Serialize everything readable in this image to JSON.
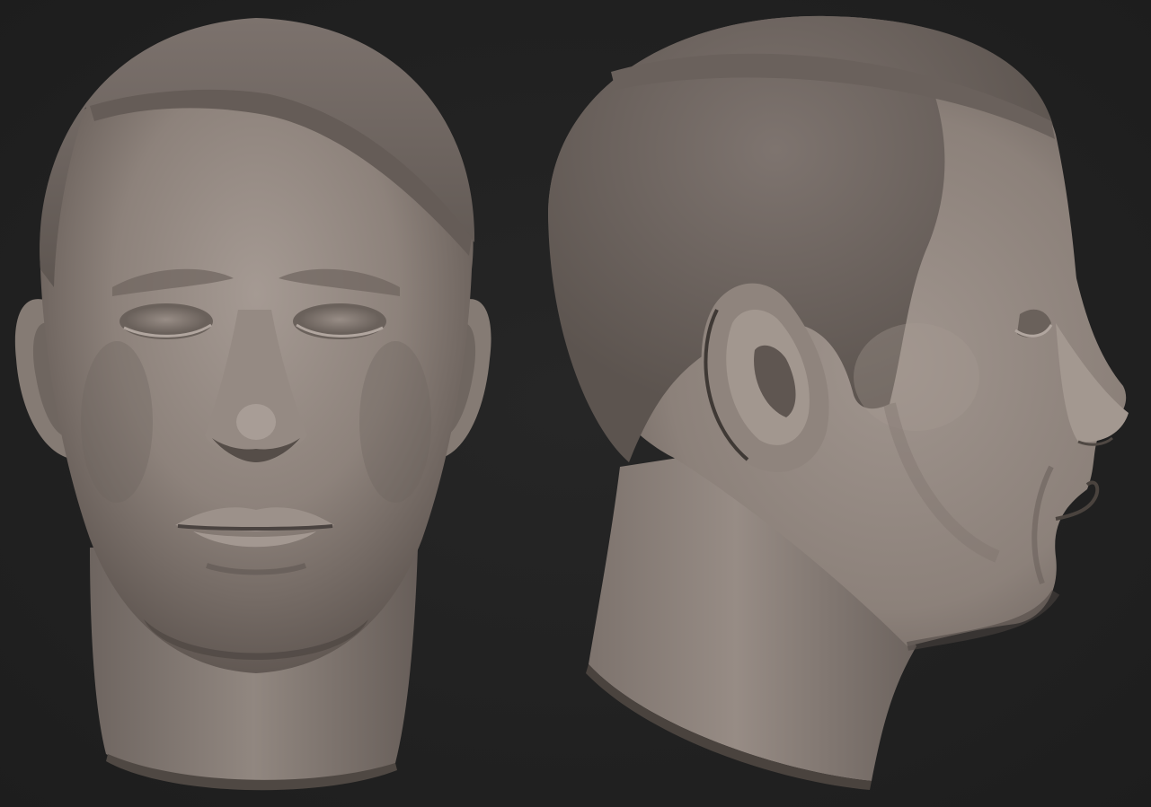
{
  "scene": {
    "background_color": "#222222",
    "skin_color": "#8f847d",
    "hair_cap_color": "#756b66",
    "views": [
      {
        "name": "front",
        "kind": "sculpt-render"
      },
      {
        "name": "side",
        "kind": "sculpt-render"
      }
    ]
  }
}
